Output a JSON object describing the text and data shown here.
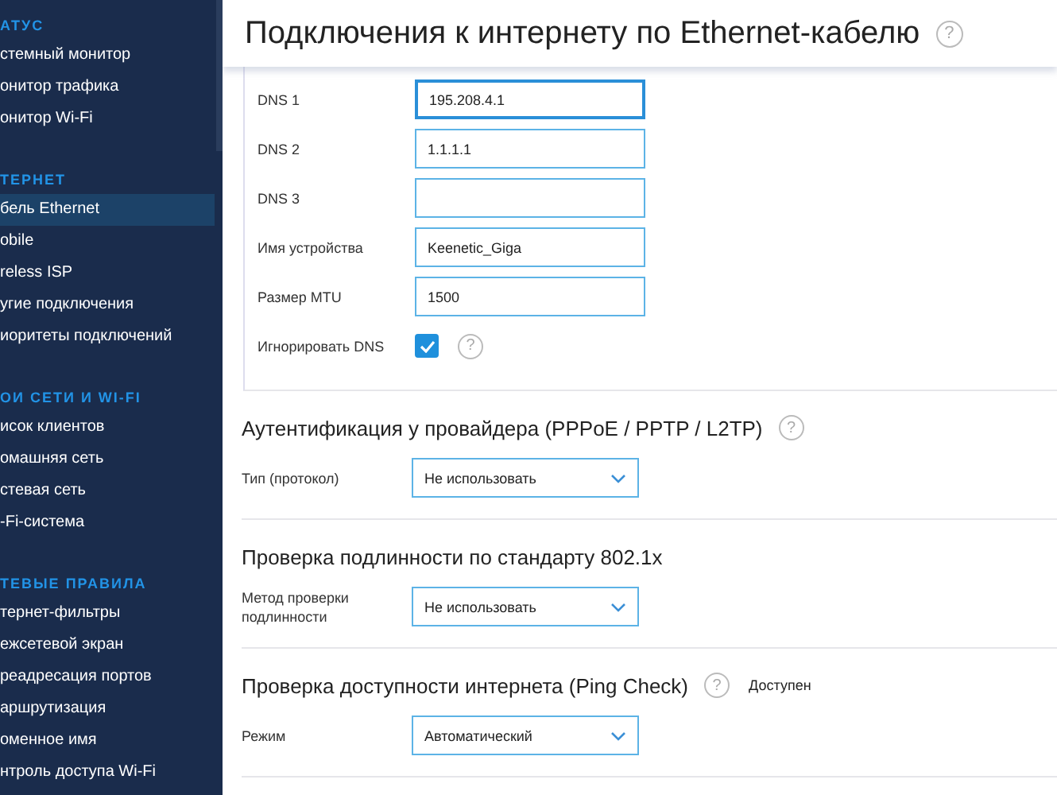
{
  "sidebar": {
    "groups": [
      {
        "title": "АТУС",
        "items": [
          {
            "label": "стемный монитор",
            "selected": false
          },
          {
            "label": "онитор трафика",
            "selected": false
          },
          {
            "label": "онитор Wi-Fi",
            "selected": false
          }
        ]
      },
      {
        "title": "ТЕРНЕТ",
        "items": [
          {
            "label": "бель Ethernet",
            "selected": true
          },
          {
            "label": "obile",
            "selected": false
          },
          {
            "label": "reless ISP",
            "selected": false
          },
          {
            "label": "угие подключения",
            "selected": false
          },
          {
            "label": "иоритеты подключений",
            "selected": false
          }
        ]
      },
      {
        "title": "ОИ СЕТИ И WI-FI",
        "items": [
          {
            "label": "исок клиентов",
            "selected": false
          },
          {
            "label": "омашняя сеть",
            "selected": false
          },
          {
            "label": "стевая сеть",
            "selected": false
          },
          {
            "label": "-Fi-система",
            "selected": false
          }
        ]
      },
      {
        "title": "ТЕВЫЕ ПРАВИЛА",
        "items": [
          {
            "label": "тернет-фильтры",
            "selected": false
          },
          {
            "label": "ежсетевой экран",
            "selected": false
          },
          {
            "label": "реадресация портов",
            "selected": false
          },
          {
            "label": "аршрутизация",
            "selected": false
          },
          {
            "label": "оменное имя",
            "selected": false
          },
          {
            "label": "нтроль доступа Wi-Fi",
            "selected": false
          }
        ]
      }
    ]
  },
  "page": {
    "title": "Подключения к интернету по Ethernet-кабелю",
    "help": "?"
  },
  "sections": [
    {
      "fields": [
        {
          "kind": "input",
          "label": "DNS 1",
          "value": "195.208.4.1",
          "focused": true
        },
        {
          "kind": "input",
          "label": "DNS 2",
          "value": "1.1.1.1",
          "focused": false
        },
        {
          "kind": "input",
          "label": "DNS 3",
          "focused": false
        },
        {
          "kind": "input",
          "label": "Имя устройства",
          "value": "Keenetic_Giga",
          "focused": false
        },
        {
          "kind": "input",
          "label": "Размер MTU",
          "value": "1500",
          "focused": false
        },
        {
          "kind": "checkbox",
          "label": "Игнорировать DNS",
          "checked": true,
          "help": "?"
        }
      ]
    },
    {
      "title": "Аутентификация у провайдера (PPPoE / PPTP / L2TP)",
      "help": "?",
      "fields": [
        {
          "kind": "select",
          "label": "Тип (протокол)",
          "value": "Не использовать"
        }
      ]
    },
    {
      "title": "Проверка подлинности по стандарту 802.1x",
      "fields": [
        {
          "kind": "select",
          "label": "Метод проверки подлинности",
          "value": "Не использовать"
        }
      ]
    },
    {
      "title": "Проверка доступности интернета (Ping Check)",
      "help": "?",
      "status": "Доступен",
      "fields": [
        {
          "kind": "select",
          "label": "Режим",
          "value": "Автоматический"
        }
      ]
    }
  ]
}
